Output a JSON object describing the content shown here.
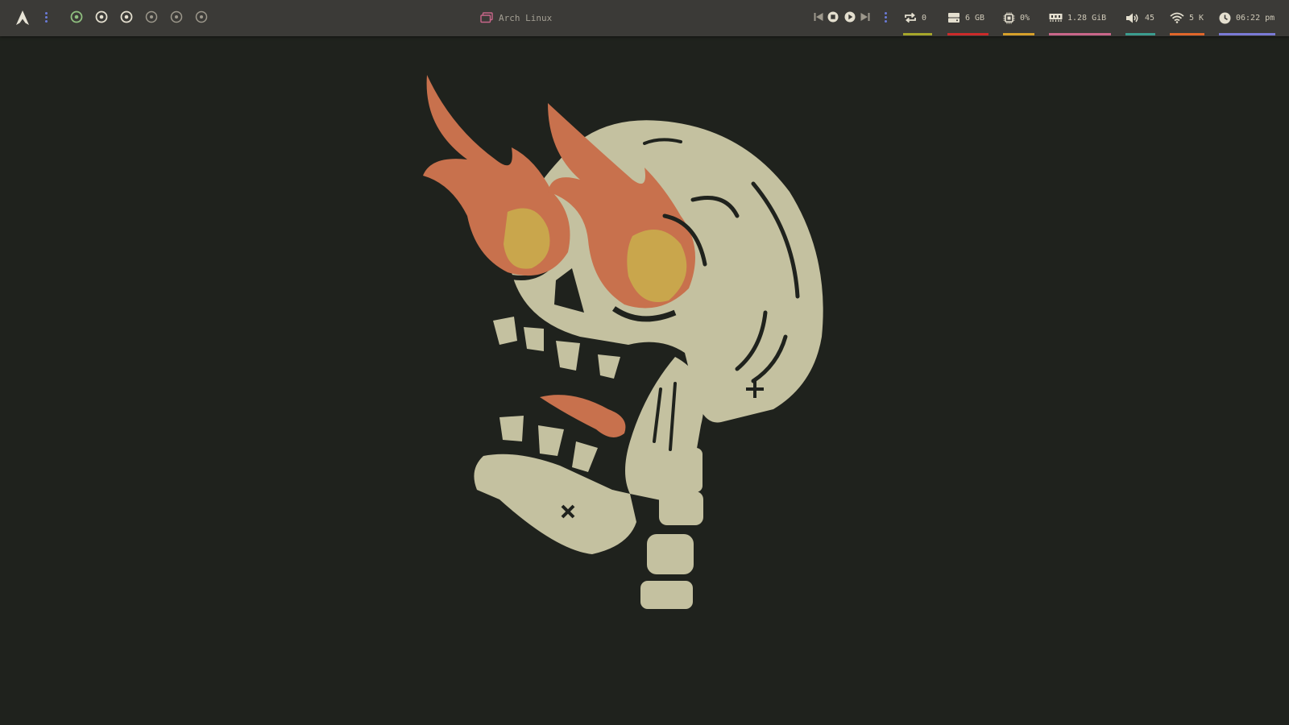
{
  "topbar": {
    "window_title": "Arch Linux",
    "workspaces": [
      {
        "state": "active",
        "color": "#8fbf7f"
      },
      {
        "state": "occupied",
        "color": "#e4dfcf"
      },
      {
        "state": "occupied",
        "color": "#e4dfcf"
      },
      {
        "state": "empty",
        "color": "#9d988c"
      },
      {
        "state": "empty",
        "color": "#9d988c"
      },
      {
        "state": "empty",
        "color": "#9d988c"
      }
    ],
    "modules": {
      "updates": {
        "icon": "refresh-icon",
        "value": "0",
        "accent": "#a6a62a"
      },
      "disk": {
        "icon": "hard-drive-icon",
        "value": "6 GB",
        "accent": "#cc2a2a"
      },
      "cpu": {
        "icon": "cpu-icon",
        "value": "0%",
        "accent": "#d6a02a"
      },
      "memory": {
        "icon": "ram-icon",
        "value": "1.28 GiB",
        "accent": "#c9668a"
      },
      "volume": {
        "icon": "speaker-icon",
        "value": "45",
        "accent": "#3b9c8e"
      },
      "network": {
        "icon": "wifi-icon",
        "value": "5 K",
        "accent": "#e0662a"
      },
      "clock": {
        "icon": "clock-icon",
        "value": "06:22 pm",
        "accent": "#7a7ad6"
      }
    },
    "colors": {
      "bar_bg": "#3b3a37",
      "desktop_bg": "#1f221d",
      "text": "#cfc9b8",
      "dots": "#6a7ad6"
    }
  },
  "wallpaper": {
    "subject": "skull-with-flaming-eyes",
    "colors": {
      "bone": "#c4c1a0",
      "flame": "#c8714d",
      "flame_core": "#c9a64c",
      "outline": "#1f221d"
    }
  }
}
